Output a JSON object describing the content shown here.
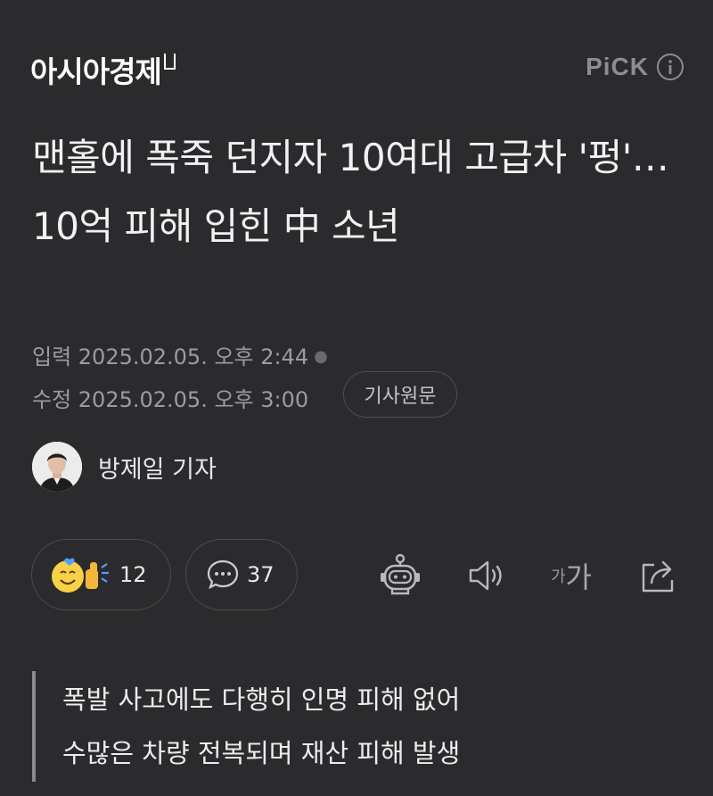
{
  "header": {
    "logo": "아시아경제",
    "pick_label": "PiCK"
  },
  "article": {
    "title": "맨홀에 폭죽 던지자 10여대 고급차 '펑'…10억 피해 입힌 中 소년",
    "input_time": "입력 2025.02.05. 오후 2:44",
    "edit_time": "수정 2025.02.05. 오후 3:00",
    "original_button": "기사원문",
    "author": "방제일 기자"
  },
  "reactions": {
    "react_count": "12",
    "comment_count": "37"
  },
  "toolbar": {
    "font_small": "가",
    "font_big": "가"
  },
  "summary": [
    "폭발 사고에도 다행히 인명 피해 없어",
    "수많은 차량 전복되며 재산 피해 발생"
  ]
}
